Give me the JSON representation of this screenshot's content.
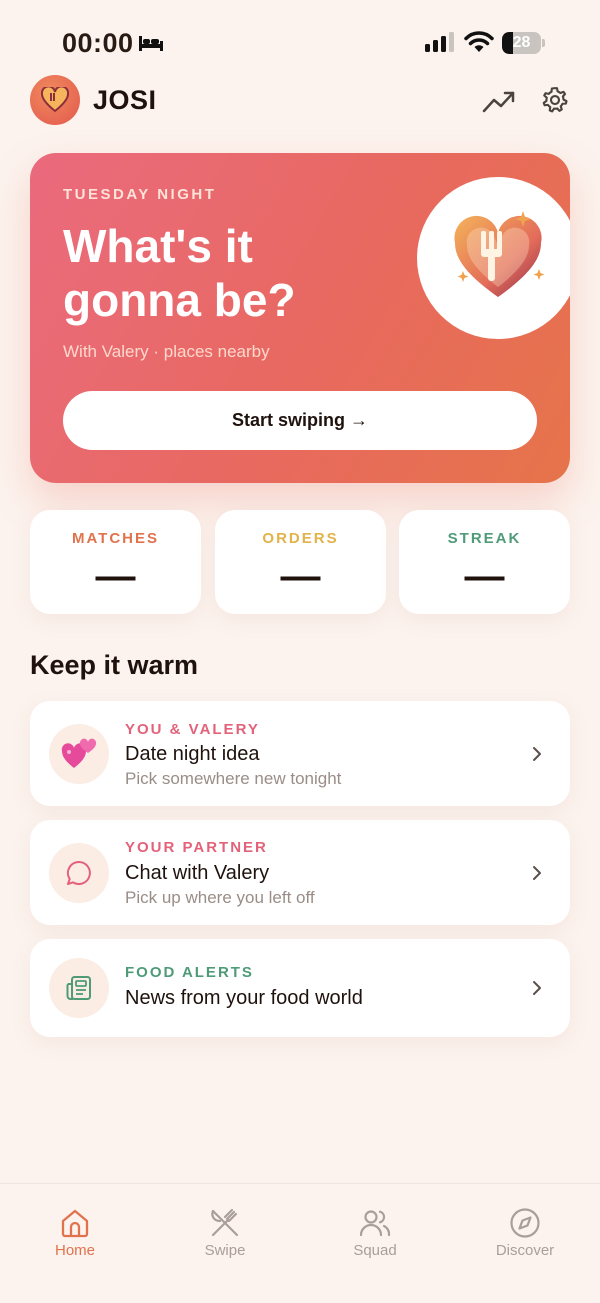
{
  "status_bar": {
    "time": "00:00",
    "battery": "28",
    "battery_level": 0.28
  },
  "header": {
    "user_name": "JOSI",
    "icons": [
      "avatar-heart-icon",
      "trending-up-icon",
      "gear-icon"
    ]
  },
  "hero": {
    "eyebrow": "TUESDAY NIGHT",
    "title": "What's it gonna be?",
    "subtitle": "With Valery · places nearby",
    "button_label": "Start swiping →",
    "badge_icon": "heart-fork-icon"
  },
  "stats": [
    {
      "label": "MATCHES",
      "value": "—",
      "color": "#e0734e"
    },
    {
      "label": "ORDERS",
      "value": "—",
      "color": "#e2b34a"
    },
    {
      "label": "STREAK",
      "value": "—",
      "color": "#4f9b78"
    }
  ],
  "section": {
    "title": "Keep it warm",
    "items": [
      {
        "eyebrow": "YOU & VALERY",
        "title": "Date night idea",
        "subtitle": "Pick somewhere new tonight",
        "icon": "two-hearts-icon",
        "eyebrow_color": "#e3627a"
      },
      {
        "eyebrow": "YOUR PARTNER",
        "title": "Chat with Valery",
        "subtitle": "Pick up where you left off",
        "icon": "chat-bubble-icon",
        "eyebrow_color": "#e3627a"
      },
      {
        "eyebrow": "FOOD ALERTS",
        "title": "News from your food world",
        "subtitle": "",
        "icon": "newspaper-icon",
        "eyebrow_color": "#4f9b78"
      }
    ]
  },
  "nav": {
    "items": [
      {
        "label": "Home",
        "icon": "home-icon",
        "active": true
      },
      {
        "label": "Swipe",
        "icon": "utensils-crossed-icon",
        "active": false
      },
      {
        "label": "Squad",
        "icon": "users-icon",
        "active": false
      },
      {
        "label": "Discover",
        "icon": "compass-icon",
        "active": false
      }
    ],
    "active_color": "#e0734e",
    "inactive_color": "#a99e99"
  }
}
